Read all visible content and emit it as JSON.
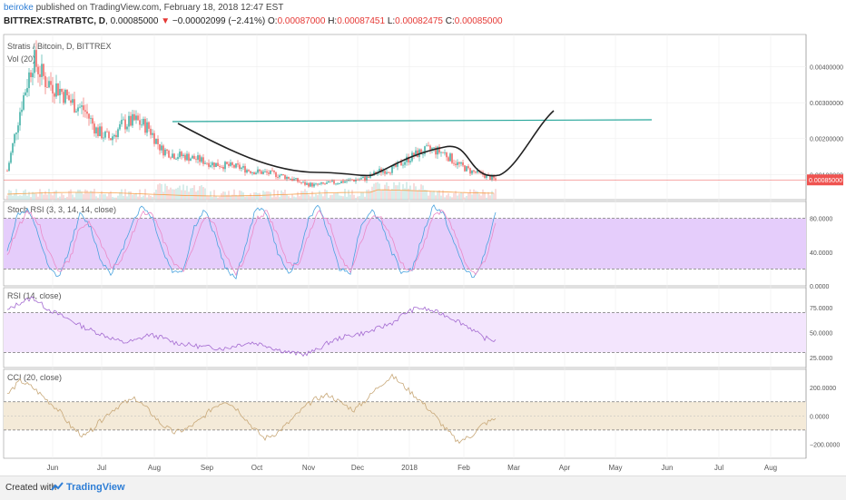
{
  "header": {
    "author": "beiroke",
    "published": "published on TradingView.com, February 18, 2018 12:47 EST",
    "symbol": "BITTREX:STRATBTC, D",
    "price": "0.00085000",
    "change": "−0.00002099 (−2.41%)",
    "o_label": "O:",
    "o_value": "0.00087000",
    "h_label": "H:",
    "h_value": "0.00087451",
    "l_label": "L:",
    "l_value": "0.00082475",
    "c_label": "C:",
    "c_value": "0.00085000"
  },
  "footer": {
    "created": "Created with",
    "brand": "TradingView"
  },
  "colors": {
    "up": "#26a69a",
    "down": "#ef5350",
    "stoch_fill": "#e5cdfb",
    "rsi_fill": "#f3e5fd",
    "cci_fill": "#f4ead8",
    "stoch_k": "#4aa3df",
    "stoch_d": "#ea8ac8",
    "rsi_line": "#a46bd1",
    "cci_line": "#c8a878",
    "trend_line": "#26a69a",
    "drawing": "#222222",
    "ma": "#f6a14a"
  },
  "chart_data": [
    {
      "type": "candlestick",
      "title": "Stratis / Bitcoin, D, BITTREX",
      "indicator": "Vol (20)",
      "y_ticks": [
        "0.00400000",
        "0.00300000",
        "0.00200000",
        "0.00100000"
      ],
      "last_price": "0.00085000",
      "ylim": [
        0.0003,
        0.0049
      ],
      "x_ticks": [
        "Jun",
        "Jul",
        "Aug",
        "Sep",
        "Oct",
        "Nov",
        "Dec",
        "2018",
        "Feb",
        "Mar",
        "Apr",
        "May",
        "Jun",
        "Jul",
        "Aug"
      ],
      "series": [
        {
          "name": "close",
          "x": [
            "2017-05-28",
            "2017-06-04",
            "2017-06-11",
            "2017-06-18",
            "2017-06-25",
            "2017-07-02",
            "2017-07-09",
            "2017-07-16",
            "2017-07-23",
            "2017-07-30",
            "2017-08-06",
            "2017-08-13",
            "2017-08-20",
            "2017-08-27",
            "2017-09-03",
            "2017-09-10",
            "2017-09-17",
            "2017-09-24",
            "2017-10-01",
            "2017-10-08",
            "2017-10-15",
            "2017-10-22",
            "2017-10-29",
            "2017-11-05",
            "2017-11-12",
            "2017-11-19",
            "2017-11-26",
            "2017-12-03",
            "2017-12-10",
            "2017-12-17",
            "2017-12-24",
            "2017-12-31",
            "2018-01-07",
            "2018-01-14",
            "2018-01-21",
            "2018-01-28",
            "2018-02-04",
            "2018-02-11",
            "2018-02-18"
          ],
          "values": [
            0.0011,
            0.0028,
            0.0042,
            0.0036,
            0.0034,
            0.003,
            0.0028,
            0.0022,
            0.002,
            0.0024,
            0.0025,
            0.0023,
            0.0017,
            0.00155,
            0.0015,
            0.0014,
            0.0013,
            0.00125,
            0.0012,
            0.0011,
            0.00105,
            0.001,
            0.0009,
            0.00075,
            0.0007,
            0.00075,
            0.0008,
            0.00085,
            0.0009,
            0.0011,
            0.00115,
            0.0014,
            0.0016,
            0.0017,
            0.0016,
            0.0013,
            0.0011,
            0.001,
            0.00085
          ]
        }
      ]
    },
    {
      "type": "line",
      "title": "Stoch RSI (3, 3, 14, 14, close)",
      "y_ticks": [
        "80.0000",
        "40.0000",
        "0.0000"
      ],
      "ylim": [
        0,
        100
      ],
      "band": [
        20,
        80
      ],
      "series": [
        {
          "name": "K",
          "values": [
            40,
            85,
            90,
            60,
            20,
            10,
            45,
            85,
            70,
            30,
            15,
            40,
            75,
            95,
            80,
            40,
            15,
            20,
            70,
            90,
            60,
            20,
            10,
            50,
            95,
            85,
            40,
            15,
            30,
            80,
            95,
            60,
            20,
            15,
            70,
            90,
            75,
            40,
            15,
            20,
            60,
            95,
            85,
            50,
            20,
            10,
            40,
            85
          ]
        },
        {
          "name": "D",
          "values": [
            35,
            70,
            88,
            75,
            40,
            18,
            30,
            70,
            75,
            50,
            22,
            30,
            60,
            88,
            85,
            55,
            25,
            18,
            50,
            82,
            72,
            35,
            15,
            35,
            80,
            88,
            60,
            25,
            25,
            60,
            88,
            75,
            35,
            18,
            50,
            82,
            80,
            55,
            25,
            18,
            45,
            85,
            88,
            65,
            30,
            15,
            30,
            75
          ]
        }
      ]
    },
    {
      "type": "line",
      "title": "RSI (14, close)",
      "y_ticks": [
        "75.0000",
        "50.0000",
        "25.0000"
      ],
      "ylim": [
        15,
        95
      ],
      "band": [
        30,
        70
      ],
      "series": [
        {
          "name": "RSI",
          "values": [
            72,
            80,
            85,
            75,
            68,
            62,
            55,
            50,
            45,
            40,
            42,
            48,
            45,
            40,
            38,
            36,
            35,
            34,
            38,
            40,
            38,
            33,
            30,
            28,
            32,
            40,
            45,
            48,
            50,
            55,
            60,
            70,
            75,
            72,
            68,
            62,
            55,
            45,
            42
          ]
        }
      ]
    },
    {
      "type": "line",
      "title": "CCI (20, close)",
      "y_ticks": [
        "200.0000",
        "0.0000",
        "−200.0000"
      ],
      "ylim": [
        -300,
        330
      ],
      "band": [
        -100,
        100
      ],
      "series": [
        {
          "name": "CCI",
          "values": [
            150,
            250,
            200,
            120,
            40,
            -80,
            -150,
            -60,
            30,
            90,
            120,
            40,
            -60,
            -120,
            -90,
            -30,
            60,
            110,
            40,
            -70,
            -160,
            -120,
            -40,
            50,
            120,
            150,
            90,
            40,
            120,
            220,
            280,
            200,
            120,
            30,
            -80,
            -180,
            -150,
            -60,
            -20
          ]
        }
      ]
    }
  ]
}
